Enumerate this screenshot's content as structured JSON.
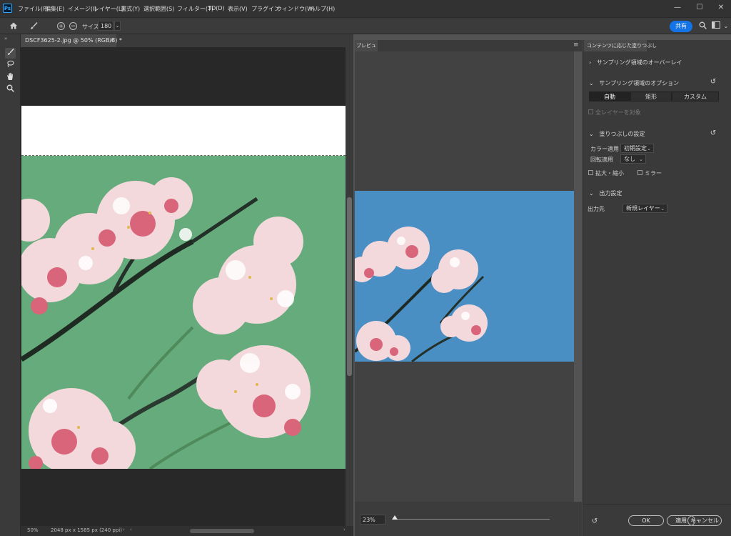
{
  "menubar": {
    "logo": "Ps",
    "items": [
      "ファイル(F)",
      "編集(E)",
      "イメージ(I)",
      "レイヤー(L)",
      "書式(Y)",
      "選択範囲(S)",
      "フィルター(T)",
      "3D(D)",
      "表示(V)",
      "プラグイン",
      "ウィンドウ(W)",
      "ヘルプ(H)"
    ],
    "window_controls": [
      "—",
      "☐",
      "✕"
    ]
  },
  "options_bar": {
    "size_label": "サイズ：",
    "size_value": "180",
    "share_label": "共有"
  },
  "document": {
    "tab_title": "DSCF3625-2.jpg @ 50% (RGB/8) *",
    "status_zoom": "50%",
    "status_info": "2048 px x 1585 px (240 ppi)"
  },
  "preview": {
    "tab_label": "プレビュー",
    "zoom_value": "23%"
  },
  "panel": {
    "tab_label": "コンテンツに応じた塗りつぶし",
    "sampling_overlay": "サンプリング領域のオーバーレイ",
    "sampling_options": "サンプリング領域のオプション",
    "sampling_modes": [
      "自動",
      "矩形",
      "カスタム"
    ],
    "sample_all_layers": "全レイヤーを対象",
    "fill_settings": "塗りつぶしの設定",
    "color_adapt_label": "カラー適用",
    "color_adapt_value": "初期設定",
    "rotation_adapt_label": "回転適用",
    "rotation_adapt_value": "なし",
    "scale_label": "拡大・縮小",
    "mirror_label": "ミラー",
    "output_settings": "出力設定",
    "output_to_label": "出力先",
    "output_to_value": "新規レイヤー",
    "ok_label": "OK",
    "apply_label": "適用",
    "cancel_label": "キャンセル"
  },
  "colors": {
    "accent": "#1473e6",
    "fill_area": "#66ab7b",
    "sky": "#4a8fc4"
  }
}
